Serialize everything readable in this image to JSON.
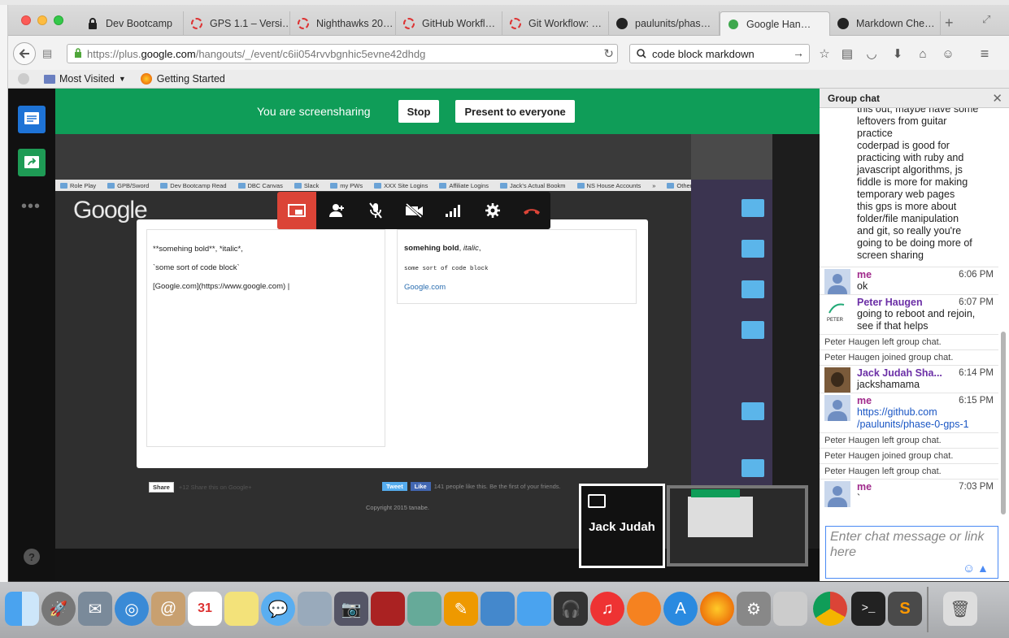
{
  "window": {
    "tabs": [
      {
        "label": "Dev Bootcamp",
        "icon": "lock-icon"
      },
      {
        "label": "GPS 1.1 – Versi…",
        "icon": "spinner-icon"
      },
      {
        "label": "Nighthawks 20…",
        "icon": "spinner-icon"
      },
      {
        "label": "GitHub Workfl…",
        "icon": "spinner-icon"
      },
      {
        "label": "Git Workflow: …",
        "icon": "spinner-icon"
      },
      {
        "label": "paulunits/phas…",
        "icon": "github-icon"
      },
      {
        "label": "Google Han…",
        "icon": "hangouts-icon",
        "active": true
      },
      {
        "label": "Markdown Che…",
        "icon": "github-icon"
      }
    ],
    "new_tab": "+"
  },
  "navbar": {
    "url_prefix": "https://plus.",
    "url_domain": "google.com",
    "url_rest": "/hangouts/_/event/c6ii054rvvbgnhic5evne42dhdg",
    "search_value": "code block markdown"
  },
  "bookmarks": {
    "most_visited": "Most Visited",
    "getting_started": "Getting Started"
  },
  "hangout": {
    "sharing_text": "You are screensharing",
    "stop_label": "Stop",
    "present_label": "Present to everyone",
    "participant_name": "Jack Judah"
  },
  "shared_screen": {
    "bookmarks": [
      "Role Play",
      "GPB/Sword",
      "Dev Bootcamp Read",
      "DBC Canvas",
      "Slack",
      "my PWs",
      "XXX Site Logins",
      "Affiliate Logins",
      "Jack's Actual Bookm",
      "NS House Accounts",
      "»",
      "Other Bookmarks"
    ],
    "logo": "Google",
    "editor_lines": [
      "**somehing bold**, *italic*,",
      "`some sort of code block`",
      "[Google.com](https://www.google.com)  |"
    ],
    "preview_bold": "somehing bold",
    "preview_italic": "italic",
    "preview_code": "some sort of code block",
    "preview_link": "Google.com",
    "share_btn": "Share",
    "share_text": "+12   Share this on Google+",
    "tweet_btn": "Tweet",
    "like_btn": "Like",
    "like_text": "141 people like this. Be the first of your friends.",
    "copyright": "Copyright 2015 tanabe."
  },
  "chat": {
    "title": "Group chat",
    "top_text_lines": [
      "this out, maybe have some",
      "leftovers from guitar",
      "practice",
      "coderpad is good for",
      "practicing with ruby and",
      "javascript algorithms, js",
      "fiddle is more for making",
      "temporary web pages",
      "this gps is more about",
      "folder/file manipulation",
      "and git, so really you're",
      "going to be doing more of",
      "screen sharing"
    ],
    "messages": [
      {
        "type": "msg",
        "who": "me",
        "time": "6:06 PM",
        "lines": [
          "ok"
        ]
      },
      {
        "type": "msg",
        "who": "Peter Haugen",
        "time": "6:07 PM",
        "lines": [
          "going to reboot and rejoin,",
          "see if that helps"
        ]
      },
      {
        "type": "sys",
        "text": "Peter Haugen left group chat."
      },
      {
        "type": "sys",
        "text": "Peter Haugen joined group chat."
      },
      {
        "type": "msg",
        "who": "Jack Judah Sha...",
        "time": "6:14 PM",
        "lines": [
          "jackshamama"
        ]
      },
      {
        "type": "msg",
        "who": "me",
        "time": "6:15 PM",
        "lines": [
          "https://github.com",
          "/paulunits/phase-0-gps-1"
        ],
        "link": true
      },
      {
        "type": "sys",
        "text": "Peter Haugen left group chat."
      },
      {
        "type": "sys",
        "text": "Peter Haugen joined group chat."
      },
      {
        "type": "sys",
        "text": "Peter Haugen left group chat."
      },
      {
        "type": "msg",
        "who": "me",
        "time": "7:03 PM",
        "lines": [
          "`"
        ]
      }
    ],
    "input_placeholder": "Enter chat message or link here"
  },
  "colors": {
    "hangout_green": "#0f9d58",
    "me_color": "#a0298b",
    "link_color": "#1a56c4"
  }
}
